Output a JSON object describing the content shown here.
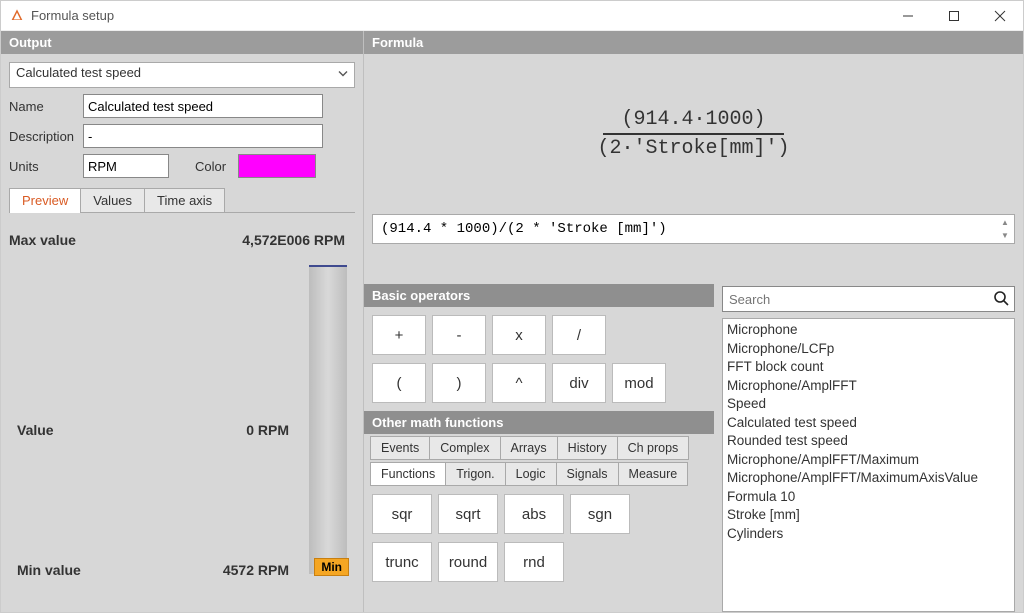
{
  "window": {
    "title": "Formula setup"
  },
  "sections": {
    "output": "Output",
    "formula": "Formula"
  },
  "output": {
    "select_value": "Calculated test speed",
    "labels": {
      "name": "Name",
      "description": "Description",
      "units": "Units",
      "color": "Color"
    },
    "name": "Calculated test speed",
    "description": "-",
    "units": "RPM",
    "color": "#FF00FF",
    "tabs": {
      "preview": "Preview",
      "values": "Values",
      "timeaxis": "Time axis"
    },
    "preview": {
      "max_label": "Max value",
      "max_value": "4,572E006 RPM",
      "value_label": "Value",
      "value_value": "0 RPM",
      "min_label": "Min value",
      "min_value": "4572 RPM",
      "min_tag": "Min"
    }
  },
  "formula": {
    "display_top": "(914.4·1000)",
    "display_bot": "(2·'Stroke[mm]')",
    "raw": "(914.4 * 1000)/(2 * 'Stroke [mm]')"
  },
  "operators": {
    "header": "Basic operators",
    "row1": [
      "+",
      "-",
      "x",
      "/"
    ],
    "row2": [
      "(",
      ")",
      "^",
      "div",
      "mod"
    ]
  },
  "functions": {
    "header": "Other math functions",
    "tabs_row1": [
      "Events",
      "Complex",
      "Arrays",
      "History",
      "Ch props"
    ],
    "tabs_row2": [
      "Functions",
      "Trigon.",
      "Logic",
      "Signals",
      "Measure"
    ],
    "active_tab": "Functions",
    "row1": [
      "sqr",
      "sqrt",
      "abs",
      "sgn"
    ],
    "row2": [
      "trunc",
      "round",
      "rnd"
    ]
  },
  "search": {
    "placeholder": "Search",
    "items": [
      "Microphone",
      "Microphone/LCFp",
      "FFT block count",
      "Microphone/AmplFFT",
      "Speed",
      "Calculated test speed",
      "Rounded test speed",
      "Microphone/AmplFFT/Maximum",
      "Microphone/AmplFFT/MaximumAxisValue",
      "Formula 10",
      "Stroke [mm]",
      "Cylinders"
    ]
  }
}
